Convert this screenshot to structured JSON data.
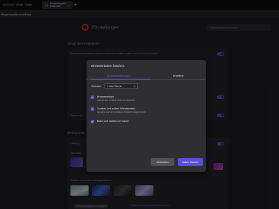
{
  "browser": {
    "tabs": [
      {
        "label": "03/12/2017 | Seite, Gesch",
        "active": false
      },
      {
        "label": "Einstellungen – Datensch",
        "active": true
      }
    ],
    "new_tab_label": "+",
    "address": "ttings/clearBrowserData"
  },
  "settings": {
    "title": "Einstellungen",
    "search_placeholder": "Einstellungen durchsuchen",
    "sidebar_label": "...",
    "privacy_section_title": "Schutz der Privatsphäre",
    "adblock_row": {
      "text": "Werbung blockieren und bis zu dreimal schneller surfen",
      "link": "Weitere Informationen"
    },
    "tracker_row": {
      "text": "Tracker bl"
    },
    "backgrounds_section_title": "Hintergrundb",
    "backgrounds_row1": {
      "text": "Hintergr"
    },
    "backgrounds_row2": {
      "text": "Alle Hinte"
    },
    "recent_backgrounds": {
      "text": "Zuletzt verwendete Hintergrundbilder"
    },
    "add_background_button": "Hintergrundbild hinzufügen",
    "more_backgrounds_link": "Weitere Hintergrundbilder erhalten"
  },
  "dialog": {
    "title": "Browserdaten löschen",
    "tabs": [
      {
        "label": "Grundeinstellungen",
        "active": true
      },
      {
        "label": "Erweitert",
        "active": false
      }
    ],
    "time_range_label": "Zeitraum",
    "time_range_value": "Letzte Stunde",
    "options": [
      {
        "title": "Browserverlauf",
        "description": "Löscht den Verlauf, auch im Suchfeld",
        "checked": true
      },
      {
        "title": "Cookies und andere Websitedaten",
        "description": "Du wirst von den meisten Websites abgemeldet",
        "checked": true
      },
      {
        "title": "Bilder und Dateien im Cache",
        "description": "",
        "checked": true
      }
    ],
    "cancel_label": "Abbrechen",
    "confirm_label": "Daten löschen"
  },
  "colors": {
    "accent": "#5a4fd8",
    "toggle_on": "#6a4ac2",
    "opera_red": "#e0282c"
  }
}
